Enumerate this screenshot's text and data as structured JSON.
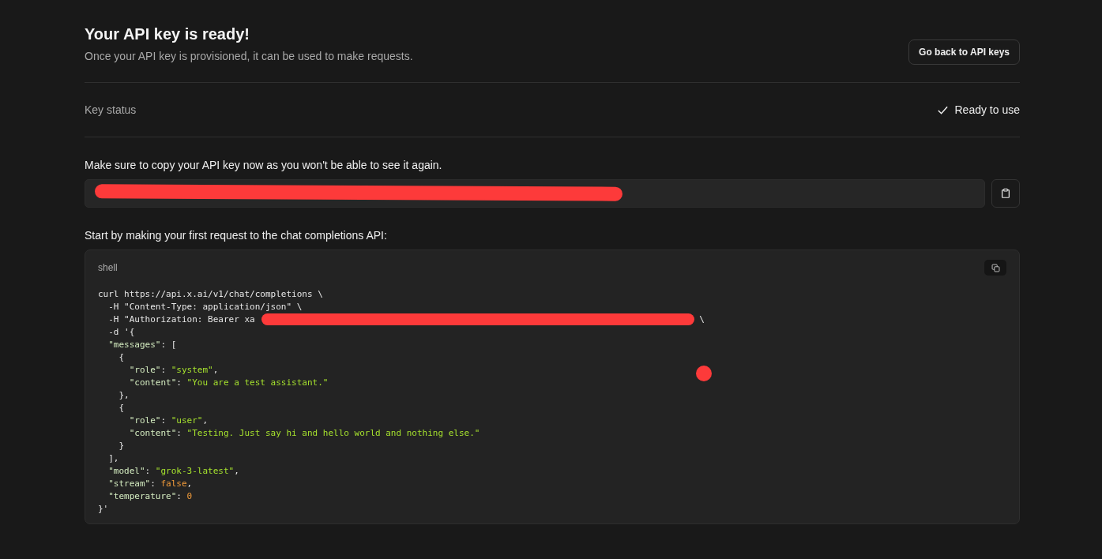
{
  "header": {
    "title": "Your API key is ready!",
    "subtitle": "Once your API key is provisioned, it can be used to make requests.",
    "back_button": "Go back to API keys"
  },
  "key_status": {
    "label": "Key status",
    "value": "Ready to use",
    "ready": true
  },
  "copy_notice": "Make sure to copy your API key now as you won't be able to see it again.",
  "intro": "Start by making your first request to the chat completions API:",
  "code_block": {
    "language": "shell",
    "lines": [
      [
        {
          "kind": "plain",
          "text": "curl https://api.x.ai/v1/chat/completions \\"
        }
      ],
      [
        {
          "kind": "plain",
          "text": "  -H \"Content-Type: application/json\" \\"
        }
      ],
      [
        {
          "kind": "plain",
          "text": "  -H \"Authorization: Bearer xa"
        },
        {
          "kind": "redacted"
        },
        {
          "kind": "plain",
          "text": " \\"
        }
      ],
      [
        {
          "kind": "plain",
          "text": "  -d '{"
        }
      ],
      [
        {
          "kind": "key",
          "text": "  \"messages\""
        },
        {
          "kind": "plain",
          "text": ": ["
        }
      ],
      [
        {
          "kind": "plain",
          "text": "    {"
        }
      ],
      [
        {
          "kind": "key",
          "text": "      \"role\""
        },
        {
          "kind": "plain",
          "text": ": "
        },
        {
          "kind": "string",
          "text": "\"system\""
        },
        {
          "kind": "plain",
          "text": ","
        }
      ],
      [
        {
          "kind": "key",
          "text": "      \"content\""
        },
        {
          "kind": "plain",
          "text": ": "
        },
        {
          "kind": "string",
          "text": "\"You are a test assistant.\""
        }
      ],
      [
        {
          "kind": "plain",
          "text": "    },"
        }
      ],
      [
        {
          "kind": "plain",
          "text": "    {"
        }
      ],
      [
        {
          "kind": "key",
          "text": "      \"role\""
        },
        {
          "kind": "plain",
          "text": ": "
        },
        {
          "kind": "string",
          "text": "\"user\""
        },
        {
          "kind": "plain",
          "text": ","
        }
      ],
      [
        {
          "kind": "key",
          "text": "      \"content\""
        },
        {
          "kind": "plain",
          "text": ": "
        },
        {
          "kind": "string",
          "text": "\"Testing. Just say hi and hello world and nothing else.\""
        }
      ],
      [
        {
          "kind": "plain",
          "text": "    }"
        }
      ],
      [
        {
          "kind": "plain",
          "text": "  ],"
        }
      ],
      [
        {
          "kind": "key",
          "text": "  \"model\""
        },
        {
          "kind": "plain",
          "text": ": "
        },
        {
          "kind": "string",
          "text": "\"grok-3-latest\""
        },
        {
          "kind": "plain",
          "text": ","
        }
      ],
      [
        {
          "kind": "key",
          "text": "  \"stream\""
        },
        {
          "kind": "plain",
          "text": ": "
        },
        {
          "kind": "literal",
          "text": "false"
        },
        {
          "kind": "plain",
          "text": ","
        }
      ],
      [
        {
          "kind": "key",
          "text": "  \"temperature\""
        },
        {
          "kind": "plain",
          "text": ": "
        },
        {
          "kind": "literal",
          "text": "0"
        }
      ],
      [
        {
          "kind": "plain",
          "text": "}'"
        }
      ]
    ]
  }
}
